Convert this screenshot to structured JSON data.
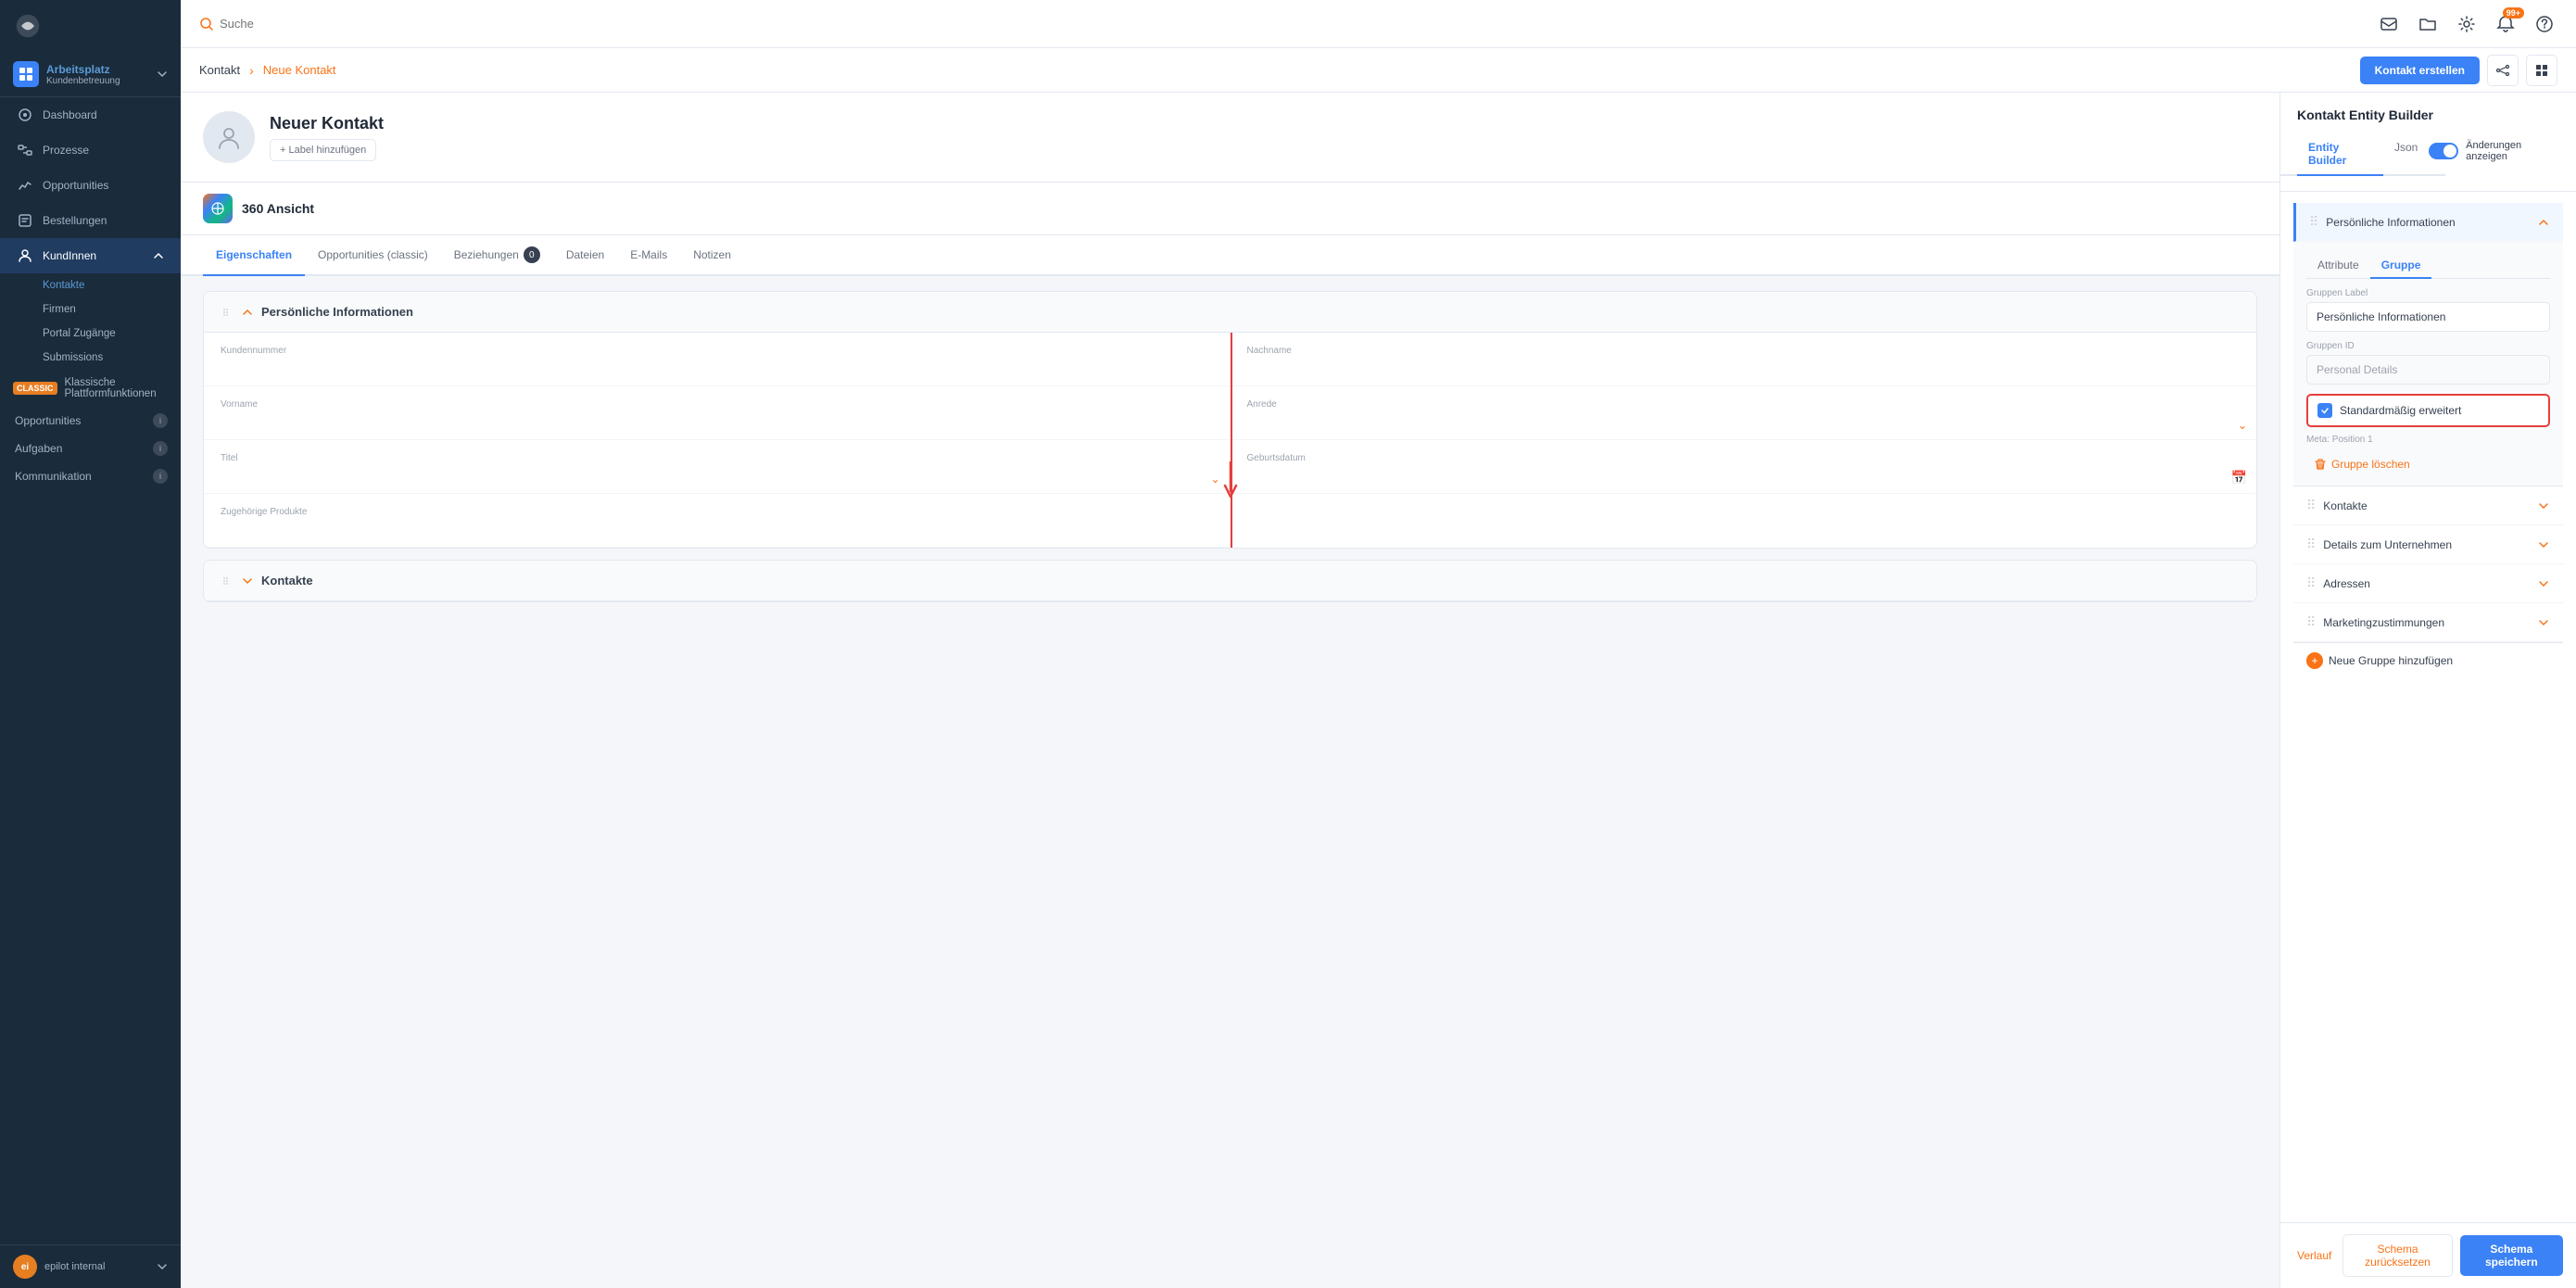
{
  "app": {
    "logo_alt": "epilot logo"
  },
  "sidebar": {
    "workspace_title": "Arbeitsplatz",
    "workspace_subtitle": "Kundenbetreuung",
    "nav_items": [
      {
        "id": "dashboard",
        "label": "Dashboard",
        "icon": "dashboard-icon"
      },
      {
        "id": "prozesse",
        "label": "Prozesse",
        "icon": "prozesse-icon"
      },
      {
        "id": "opportunities",
        "label": "Opportunities",
        "icon": "opportunities-icon"
      },
      {
        "id": "bestellungen",
        "label": "Bestellungen",
        "icon": "bestellungen-icon"
      },
      {
        "id": "kundinnen",
        "label": "KundInnen",
        "icon": "kundinnen-icon",
        "active": true
      }
    ],
    "sub_items": [
      {
        "id": "kontakte",
        "label": "Kontakte",
        "active": true
      },
      {
        "id": "firmen",
        "label": "Firmen"
      },
      {
        "id": "portal-zugange",
        "label": "Portal Zugänge"
      },
      {
        "id": "submissions",
        "label": "Submissions"
      }
    ],
    "classic_label": "CLASSIC",
    "classic_section": "Klassische Plattformfunktionen",
    "bottom_sections": [
      {
        "id": "opportunities-bottom",
        "label": "Opportunities"
      },
      {
        "id": "aufgaben",
        "label": "Aufgaben"
      },
      {
        "id": "kommunikation",
        "label": "Kommunikation"
      }
    ],
    "user_name": "epilot internal",
    "user_initials": "ei"
  },
  "topbar": {
    "search_placeholder": "Suche"
  },
  "breadcrumb": {
    "parent": "Kontakt",
    "current": "Neue Kontakt"
  },
  "toolbar": {
    "create_button": "Kontakt erstellen"
  },
  "contact": {
    "name": "Neuer Kontakt",
    "add_label_button": "+ Label hinzufügen"
  },
  "view360": {
    "title": "360 Ansicht"
  },
  "tabs": [
    {
      "id": "eigenschaften",
      "label": "Eigenschaften",
      "active": true
    },
    {
      "id": "opportunities-classic",
      "label": "Opportunities (classic)"
    },
    {
      "id": "beziehungen",
      "label": "Beziehungen",
      "badge": "0"
    },
    {
      "id": "dateien",
      "label": "Dateien"
    },
    {
      "id": "emails",
      "label": "E-Mails"
    },
    {
      "id": "notizen",
      "label": "Notizen"
    }
  ],
  "form_sections": [
    {
      "id": "persoenliche-info",
      "title": "Persönliche Informationen",
      "expanded": true,
      "fields": [
        {
          "label": "Kundennummer",
          "value": ""
        },
        {
          "label": "Nachname",
          "value": ""
        },
        {
          "label": "Vorname",
          "value": ""
        },
        {
          "label": "Anrede",
          "value": "",
          "has_dropdown": true
        },
        {
          "label": "Titel",
          "value": "",
          "has_dropdown": true
        },
        {
          "label": "Geburtsdatum",
          "value": "",
          "has_calendar": true
        },
        {
          "label": "Zugehörige Produkte",
          "value": ""
        }
      ]
    },
    {
      "id": "kontakte-section",
      "title": "Kontakte",
      "expanded": false,
      "fields": []
    }
  ],
  "entity_builder": {
    "title": "Kontakt Entity Builder",
    "tabs": [
      {
        "id": "entity-builder",
        "label": "Entity Builder",
        "active": true
      },
      {
        "id": "json",
        "label": "Json"
      }
    ],
    "toggle_label": "Änderungen anzeigen",
    "toggle_on": true,
    "attr_group_tabs": [
      {
        "id": "attribute",
        "label": "Attribute"
      },
      {
        "id": "gruppe",
        "label": "Gruppe",
        "active": true
      }
    ],
    "group_editor": {
      "gruppen_label_label": "Gruppen Label",
      "gruppen_label_value": "Persönliche Informationen",
      "gruppen_id_label": "Gruppen ID",
      "gruppen_id_value": "Personal Details",
      "checkbox_label": "Standardmäßig erweitert",
      "checkbox_checked": true,
      "meta_text": "Meta: Position 1",
      "delete_button": "Gruppe löschen"
    },
    "sections": [
      {
        "id": "persoenliche-info-eb",
        "label": "Persönliche Informationen",
        "expanded": true
      },
      {
        "id": "kontakte-eb",
        "label": "Kontakte",
        "expanded": false
      },
      {
        "id": "details-unternehmen",
        "label": "Details zum Unternehmen",
        "expanded": false
      },
      {
        "id": "adressen",
        "label": "Adressen",
        "expanded": false
      },
      {
        "id": "marketingzustimmungen",
        "label": "Marketingzustimmungen",
        "expanded": false
      }
    ],
    "add_group_button": "Neue Gruppe hinzufügen",
    "footer": {
      "verlauf_button": "Verlauf",
      "reset_button": "Schema zurücksetzen",
      "save_button": "Schema speichern"
    }
  }
}
